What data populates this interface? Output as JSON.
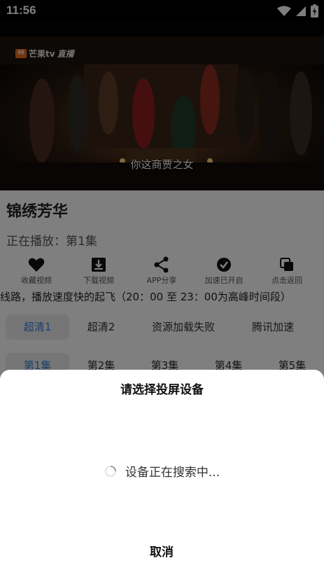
{
  "status_bar": {
    "time": "11:56"
  },
  "video": {
    "logo_text": "芒果tv",
    "logo_badge": "直播",
    "subtitle": "你这商贾之女"
  },
  "show": {
    "title": "锦绣芳华",
    "now_playing": "正在播放：第1集"
  },
  "actions": [
    {
      "label": "收藏视频",
      "icon": "heart-icon"
    },
    {
      "label": "下载视频",
      "icon": "download-icon"
    },
    {
      "label": "APP分享",
      "icon": "share-icon"
    },
    {
      "label": "加速已开启",
      "icon": "check-circle-icon"
    },
    {
      "label": "点击返回",
      "icon": "copy-icon"
    }
  ],
  "notice": "线路，播放速度快的起飞（20：00 至 23：00为高峰时间段）",
  "lines": [
    "超清1",
    "超清2",
    "资源加载失败",
    "腾讯加速"
  ],
  "episodes": [
    "第1集",
    "第2集",
    "第3集",
    "第4集",
    "第5集"
  ],
  "cast_dialog": {
    "title": "请选择投屏设备",
    "searching": "设备正在搜索中...",
    "cancel": "取消"
  },
  "colors": {
    "accent": "#3b82d6",
    "overlay": "rgba(0,0,0,0.5)"
  }
}
